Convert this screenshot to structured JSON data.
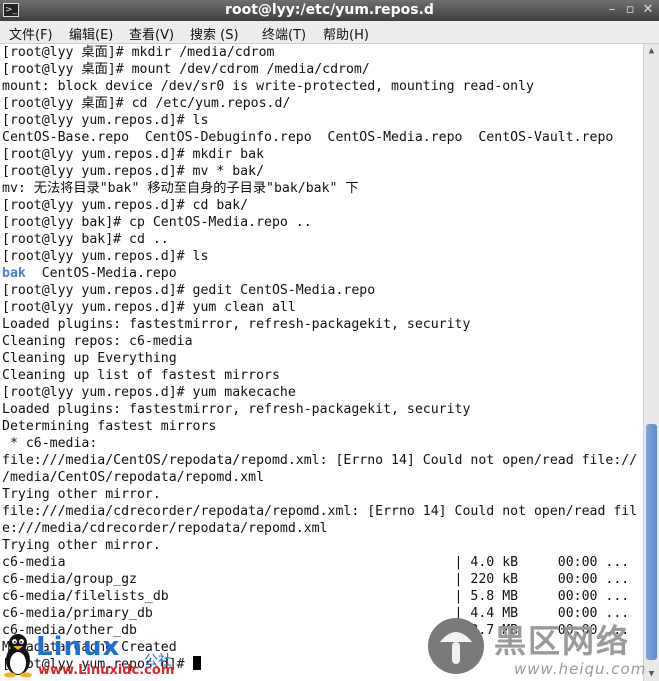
{
  "window": {
    "title": "root@lyy:/etc/yum.repos.d",
    "app_icon_glyph": ">_",
    "min_glyph": "–",
    "max_glyph": "▫",
    "close_glyph": "✕"
  },
  "menu": [
    "文件(F)",
    "编辑(E)",
    "查看(V)",
    "搜索 (S)",
    "终端(T)",
    "帮助(H)"
  ],
  "terminal_lines": [
    "[root@lyy 桌面]# mkdir /media/cdrom",
    "[root@lyy 桌面]# mount /dev/cdrom /media/cdrom/",
    "mount: block device /dev/sr0 is write-protected, mounting read-only",
    "[root@lyy 桌面]# cd /etc/yum.repos.d/",
    "[root@lyy yum.repos.d]# ls",
    "CentOS-Base.repo  CentOS-Debuginfo.repo  CentOS-Media.repo  CentOS-Vault.repo",
    "[root@lyy yum.repos.d]# mkdir bak",
    "[root@lyy yum.repos.d]# mv * bak/",
    "mv: 无法将目录\"bak\" 移动至自身的子目录\"bak/bak\" 下",
    "[root@lyy yum.repos.d]# cd bak/",
    "[root@lyy bak]# cp CentOS-Media.repo ..",
    "[root@lyy bak]# cd ..",
    "[root@lyy yum.repos.d]# ls",
    "__LS__",
    "[root@lyy yum.repos.d]# gedit CentOS-Media.repo",
    "[root@lyy yum.repos.d]# yum clean all",
    "Loaded plugins: fastestmirror, refresh-packagekit, security",
    "Cleaning repos: c6-media",
    "Cleaning up Everything",
    "Cleaning up list of fastest mirrors",
    "[root@lyy yum.repos.d]# yum makecache",
    "Loaded plugins: fastestmirror, refresh-packagekit, security",
    "Determining fastest mirrors",
    " * c6-media:",
    "file:///media/CentOS/repodata/repomd.xml: [Errno 14] Could not open/read file://",
    "/media/CentOS/repodata/repomd.xml",
    "Trying other mirror.",
    "file:///media/cdrecorder/repodata/repomd.xml: [Errno 14] Could not open/read fil",
    "e:///media/cdrecorder/repodata/repomd.xml",
    "Trying other mirror.",
    "c6-media                                                 | 4.0 kB     00:00 ...",
    "c6-media/group_gz                                        | 220 kB     00:00 ...",
    "c6-media/filelists_db                                    | 5.8 MB     00:00 ...",
    "c6-media/primary_db                                      | 4.4 MB     00:00 ...",
    "c6-media/other_db                                        | 2.7 MB     00:00 ...",
    "Metadata Cache Created",
    "__PROMPT__"
  ],
  "ls_output": {
    "dir": "bak",
    "file": "CentOS-Media.repo"
  },
  "prompt_current": "[root@lyy yum.repos.d]# ",
  "watermark_left": {
    "brand": "Linux",
    "cn": "公社",
    "url": "www.Linuxidc.com"
  },
  "watermark_right": {
    "cn": "黑区网络",
    "url": "www.heiqu.com"
  },
  "colors": {
    "dir": "#4a7fd4",
    "brand": "#1e6fd0",
    "url_red": "#e0262b"
  },
  "icons": [
    "terminal-icon",
    "minimize-icon",
    "maximize-icon",
    "close-icon",
    "linux-tux-logo",
    "heiqu-logo"
  ]
}
